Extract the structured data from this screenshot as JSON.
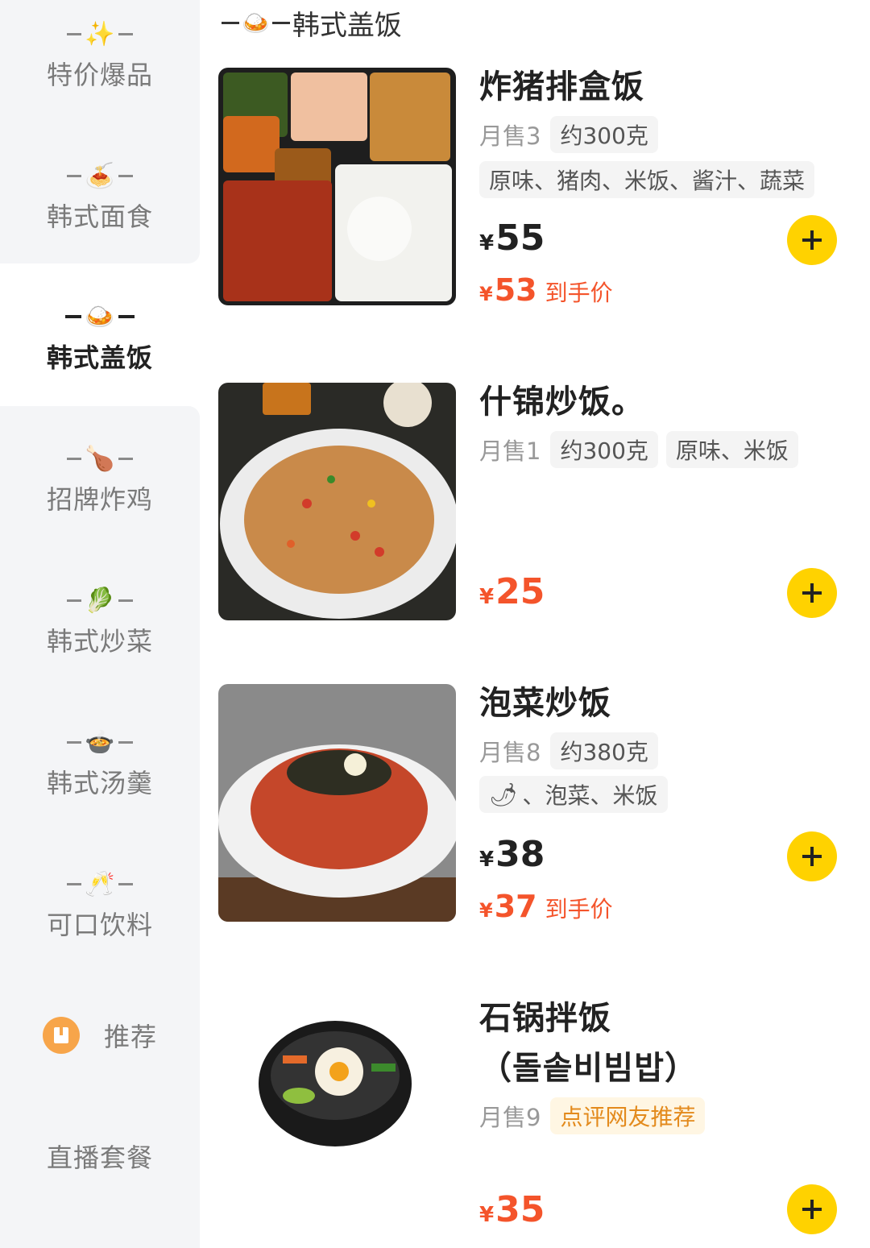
{
  "sidebar": {
    "items": [
      {
        "label": "特价爆品",
        "icon": "✨",
        "icon_name": "sparkles-icon"
      },
      {
        "label": "韩式面食",
        "icon": "🍝",
        "icon_name": "noodle-bowl-icon"
      },
      {
        "label": "韩式盖饭",
        "icon": "🍛",
        "icon_name": "rice-bowl-icon",
        "active": true
      },
      {
        "label": "招牌炸鸡",
        "icon": "🍗",
        "icon_name": "drumstick-icon"
      },
      {
        "label": "韩式炒菜",
        "icon": "🥬",
        "icon_name": "leafy-green-icon"
      },
      {
        "label": "韩式汤羹",
        "icon": "🍲",
        "icon_name": "soup-bowl-icon"
      },
      {
        "label": "可口饮料",
        "icon": "🥂",
        "icon_name": "champagne-glasses-icon"
      },
      {
        "label": "推荐",
        "icon_name": "recommend-badge-icon"
      },
      {
        "label": "直播套餐"
      }
    ]
  },
  "section": {
    "title": "韩式盖饭",
    "icon": "🍛"
  },
  "products": [
    {
      "name": "炸猪排盒饭",
      "sold": "月售3",
      "tags": [
        "约300克",
        "原味、猪肉、米饭、酱汁、蔬菜"
      ],
      "price_currency": "¥",
      "price": "55",
      "final_currency": "¥",
      "final_price": "53",
      "final_suffix": "到手价"
    },
    {
      "name": "什锦炒饭。",
      "sold": "月售1",
      "tags": [
        "约300克",
        "原味、米饭"
      ],
      "price_currency": "¥",
      "price": "25"
    },
    {
      "name": "泡菜炒饭",
      "sold": "月售8",
      "tags": [
        "约380克",
        "、泡菜、米饭"
      ],
      "chili_icon": "🌶",
      "price_currency": "¥",
      "price": "38",
      "final_currency": "¥",
      "final_price": "37",
      "final_suffix": "到手价"
    },
    {
      "name_line1": "石锅拌饭",
      "name_line2": "（돌솥비빔밥）",
      "sold": "月售9",
      "badge": "点评网友推荐",
      "price_currency": "¥",
      "price": "35"
    }
  ],
  "colors": {
    "accent": "#ffd200",
    "price_red": "#f4542b",
    "sidebar_bg": "#f4f5f7"
  }
}
